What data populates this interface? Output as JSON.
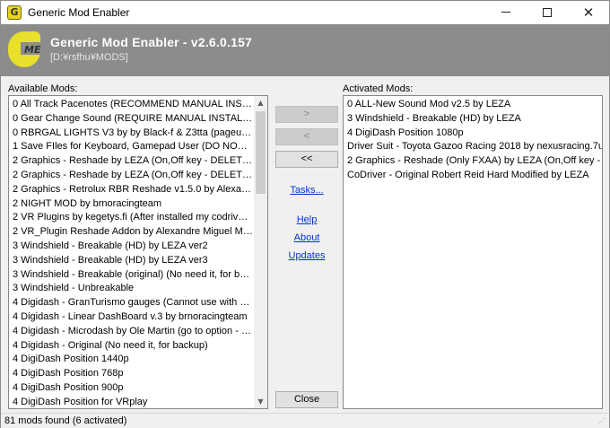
{
  "window": {
    "title": "Generic Mod Enabler",
    "icon": "gme-app-icon"
  },
  "header": {
    "app_name": "Generic Mod Enabler - v2.6.0.157",
    "path": "[D:¥rsfhu¥MODS]",
    "logo_letter": "G",
    "logo_suffix": "ME"
  },
  "available": {
    "label": "Available Mods:",
    "items": [
      "0 All Track Pacenotes (RECOMMEND MANUAL INSTALL-CO...",
      "0 Gear Change Sound (REQUIRE MANUAL INSTALL only for ...",
      "0 RBRGAL LIGHTS V3 by by Black-f & Z3tta (pageup,down o...",
      "1 Save FIles for Keyboard, Gamepad User (DO NOT USE WIT...",
      "2 Graphics - Reshade by LEZA (On,Off key - DELETE) Brighte...",
      "2 Graphics - Reshade by LEZA (On,Off key - DELETE) Darker ...",
      "2 Graphics - Retrolux RBR Reshade v1.5.0 by Alexandre Mig...",
      "2 NIGHT MOD by brnoracingteam",
      "2 VR Plugins by kegetys.fi (After installed my codriver mods,...",
      "2 VR_Plugin Reshade Addon by Alexandre Miguel Maia",
      "3 Windshield - Breakable (HD) by LEZA ver2",
      "3 Windshield - Breakable (HD) by LEZA ver3",
      "3 Windshield - Breakable (original) (No need it, for backup)",
      "3 Windshield - Unbreakable",
      "4 Digidash - GranTurismo gauges (Cannot use with Reshade ...",
      "4 Digidash - Linear DashBoard v.3 by brnoracingteam",
      "4 Digidash - Microdash by Ole Martin (go to option - screen...",
      "4 Digidash - Original (No need it, for backup)",
      "4 DigiDash Position 1440p",
      "4 DigiDash Position 768p",
      "4 DigiDash Position 900p",
      "4 DigiDash Position for VRplay"
    ]
  },
  "activated": {
    "label": "Activated Mods:",
    "items": [
      "0 ALL-New Sound Mod v2.5 by LEZA",
      "3 Windshield - Breakable (HD) by LEZA",
      "4 DigiDash Position 1080p",
      "Driver Suit - Toyota Gazoo Racing 2018 by nexusracing.7u.cz",
      "2 Graphics - Reshade (Only FXAA) by LEZA (On,Off key - DELETE)",
      "CoDriver - Original Robert Reid Hard Modified by LEZA"
    ]
  },
  "buttons": {
    "add": ">",
    "remove": "<",
    "remove_all": "<<",
    "close": "Close"
  },
  "links": {
    "tasks": "Tasks...",
    "help": "Help",
    "about": "About",
    "updates": "Updates"
  },
  "status": {
    "text": "81 mods found (6 activated)"
  },
  "colors": {
    "header_bg": "#8c8c8c",
    "logo_yellow": "#e8e02a",
    "link": "#0033cc",
    "list_bg": "#ffffff",
    "window_bg": "#f0f0f0"
  }
}
